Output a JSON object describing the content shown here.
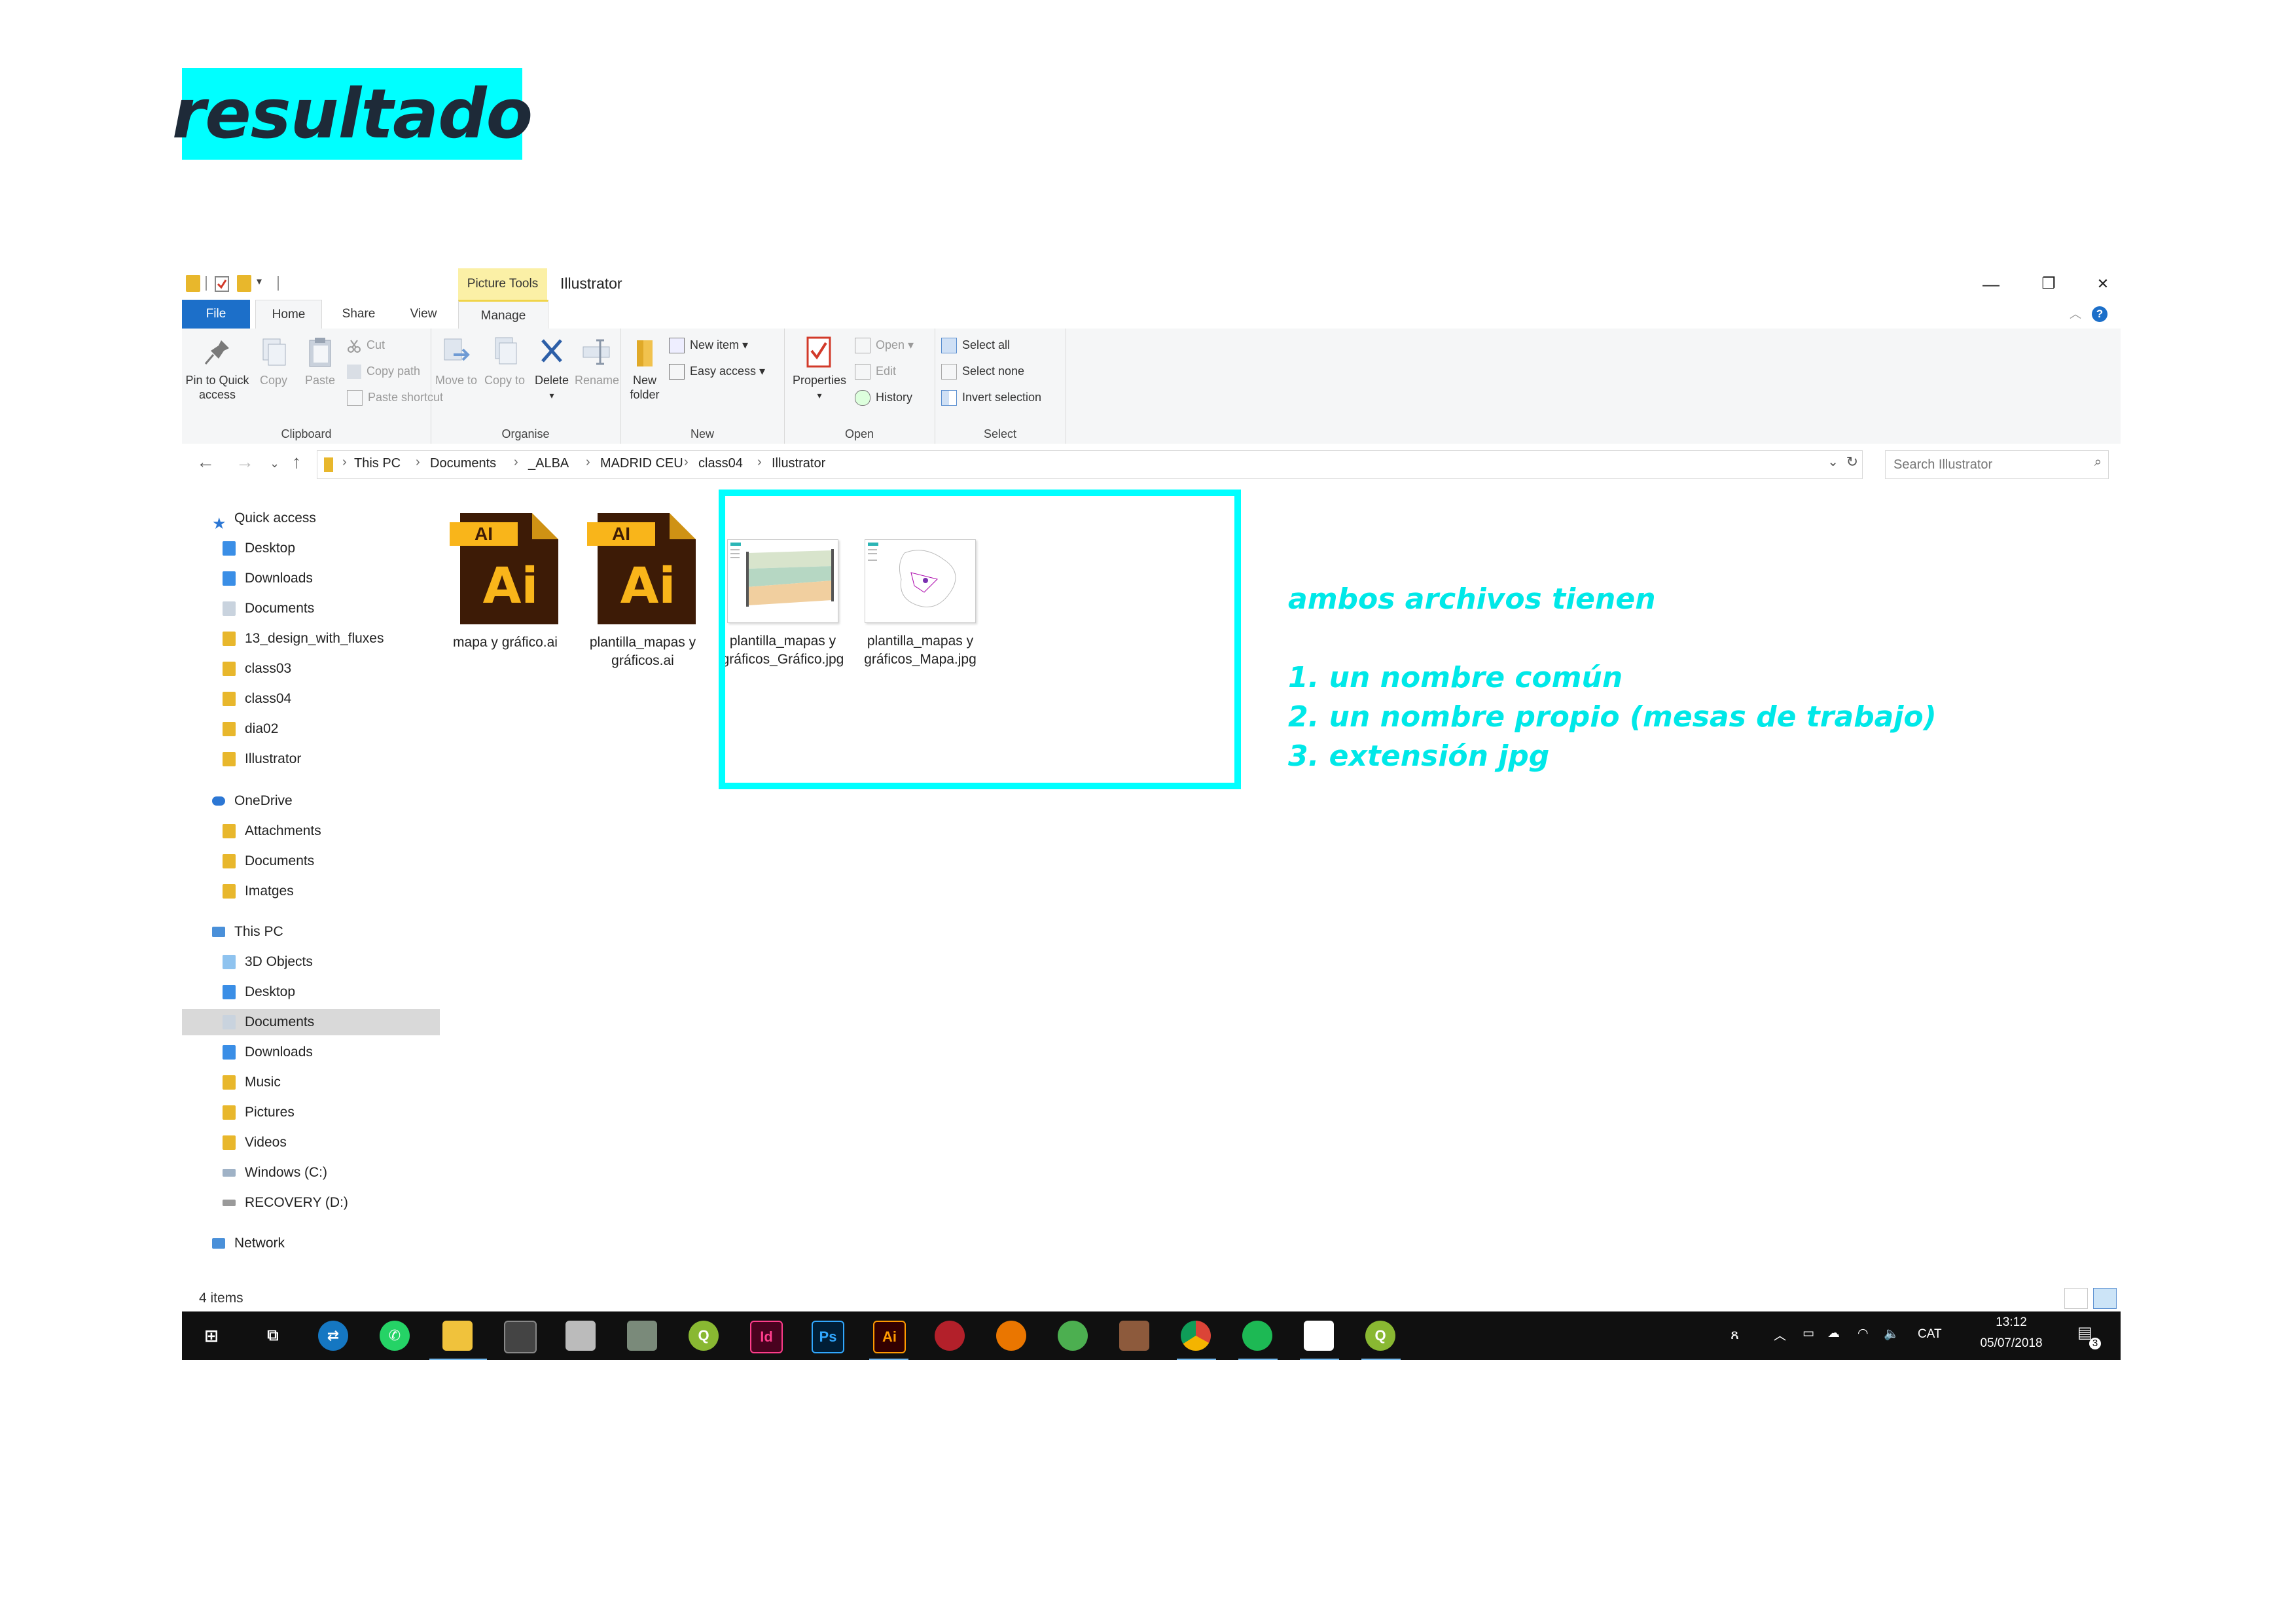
{
  "slide_title": "resultado",
  "window": {
    "context_tab": "Picture Tools",
    "title": "Illustrator",
    "controls": {
      "minimize": "—",
      "restore": "❐",
      "close": "✕"
    },
    "tabs": {
      "file": "File",
      "home": "Home",
      "share": "Share",
      "view": "View",
      "manage": "Manage"
    },
    "help": "?"
  },
  "ribbon": {
    "clipboard": {
      "label": "Clipboard",
      "pin": "Pin to Quick access",
      "copy": "Copy",
      "paste": "Paste",
      "cut": "Cut",
      "copy_path": "Copy path",
      "paste_shortcut": "Paste shortcut"
    },
    "organise": {
      "label": "Organise",
      "move_to": "Move to",
      "copy_to": "Copy to",
      "delete": "Delete",
      "rename": "Rename"
    },
    "new": {
      "label": "New",
      "new_folder": "New folder",
      "new_item": "New item ▾",
      "easy_access": "Easy access ▾"
    },
    "open": {
      "label": "Open",
      "properties": "Properties",
      "open": "Open ▾",
      "edit": "Edit",
      "history": "History"
    },
    "select": {
      "label": "Select",
      "select_all": "Select all",
      "select_none": "Select none",
      "invert": "Invert selection"
    }
  },
  "address": {
    "crumbs": [
      "This PC",
      "Documents",
      "_ALBA",
      "MADRID CEU",
      "class04",
      "Illustrator"
    ],
    "search_placeholder": "Search Illustrator"
  },
  "nav": {
    "quick_access": "Quick access",
    "quick_items": [
      "Desktop",
      "Downloads",
      "Documents",
      "13_design_with_fluxes",
      "class03",
      "class04",
      "dia02",
      "Illustrator"
    ],
    "onedrive": "OneDrive",
    "onedrive_items": [
      "Attachments",
      "Documents",
      "Imatges"
    ],
    "this_pc": "This PC",
    "pc_items": [
      "3D Objects",
      "Desktop",
      "Documents",
      "Downloads",
      "Music",
      "Pictures",
      "Videos",
      "Windows (C:)",
      "RECOVERY (D:)"
    ],
    "network": "Network"
  },
  "files": [
    {
      "name": "mapa y gráfico.ai",
      "type": "ai",
      "badge": "AI",
      "glyph": "Ai"
    },
    {
      "name": "plantilla_mapas y gráficos.ai",
      "type": "ai",
      "badge": "AI",
      "glyph": "Ai"
    },
    {
      "name": "plantilla_mapas y gráficos_Gráfico.jpg",
      "type": "jpg"
    },
    {
      "name": "plantilla_mapas y gráficos_Mapa.jpg",
      "type": "jpg"
    }
  ],
  "status": {
    "items": "4 items"
  },
  "taskbar": {
    "language": "CAT",
    "time": "13:12",
    "date": "05/07/2018",
    "notifications": "3",
    "apps": [
      "Id",
      "Ps",
      "Ai"
    ]
  },
  "annotation": {
    "heading": "ambos archivos tienen",
    "points": [
      "1. un nombre común",
      "2. un nombre propio (mesas de trabajo)",
      "3. extensión jpg"
    ]
  },
  "colors": {
    "accent": "#00ffff",
    "file_tab": "#1c6fc9",
    "context_tab": "#fbf0a6",
    "ai_dark": "#3d1b06",
    "ai_orange": "#f9b51a"
  }
}
